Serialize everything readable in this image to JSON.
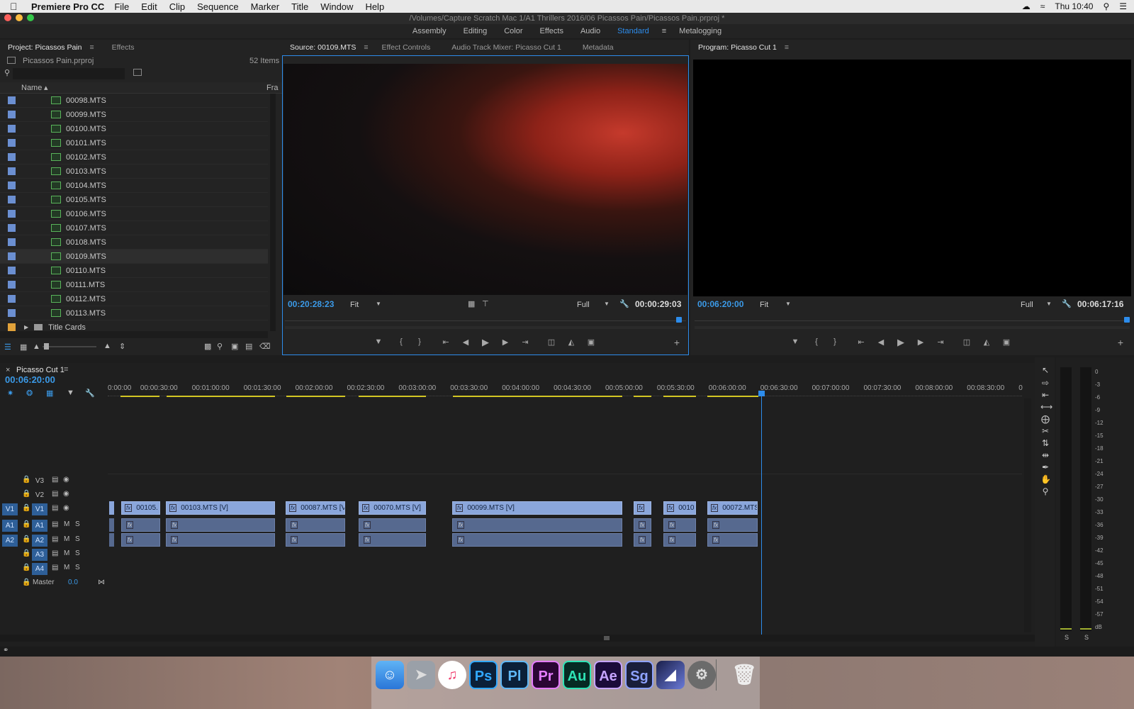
{
  "menubar": {
    "apple": "",
    "app": "Premiere Pro CC",
    "items": [
      "File",
      "Edit",
      "Clip",
      "Sequence",
      "Marker",
      "Title",
      "Window",
      "Help"
    ],
    "clock": "Thu 10:40"
  },
  "window": {
    "title": "/Volumes/Capture Scratch Mac 1/A1 Thrillers 2016/06 Picassos Pain/Picassos Pain.prproj *"
  },
  "workspaces": [
    "Assembly",
    "Editing",
    "Color",
    "Effects",
    "Audio",
    "Standard",
    "Metalogging"
  ],
  "workspace_active": "Standard",
  "project": {
    "tab_project": "Project: Picassos Pain",
    "tab_effects": "Effects",
    "file": "Picassos Pain.prproj",
    "count": "52 Items",
    "col_name": "Name",
    "col_fra": "Fra",
    "items": [
      "00098.MTS",
      "00099.MTS",
      "00100.MTS",
      "00101.MTS",
      "00102.MTS",
      "00103.MTS",
      "00104.MTS",
      "00105.MTS",
      "00106.MTS",
      "00107.MTS",
      "00108.MTS",
      "00109.MTS",
      "00110.MTS",
      "00111.MTS",
      "00112.MTS",
      "00113.MTS"
    ],
    "selected": "00109.MTS",
    "folder": "Title Cards"
  },
  "source": {
    "tabs": [
      "Source: 00109.MTS",
      "Effect Controls",
      "Audio Track Mixer: Picasso Cut 1",
      "Metadata"
    ],
    "timecode": "00:20:28:23",
    "fit": "Fit",
    "quality": "Full",
    "duration": "00:00:29:03"
  },
  "program": {
    "tab": "Program: Picasso Cut 1",
    "timecode": "00:06:20:00",
    "fit": "Fit",
    "quality": "Full",
    "duration": "00:06:17:16"
  },
  "timeline": {
    "tab": "Picasso Cut 1",
    "timecode": "00:06:20:00",
    "ruler": [
      "0:00:00",
      "00:00:30:00",
      "00:01:00:00",
      "00:01:30:00",
      "00:02:00:00",
      "00:02:30:00",
      "00:03:00:00",
      "00:03:30:00",
      "00:04:00:00",
      "00:04:30:00",
      "00:05:00:00",
      "00:05:30:00",
      "00:06:00:00",
      "00:06:30:00",
      "00:07:00:00",
      "00:07:30:00",
      "00:08:00:00",
      "00:08:30:00",
      "0"
    ],
    "tracks": {
      "v3": "V3",
      "v2": "V2",
      "v1": "V1",
      "a1": "A1",
      "a2": "A2",
      "a3": "A3",
      "a4": "A4",
      "master": "Master",
      "master_val": "0.0",
      "src_v1": "V1",
      "src_a1": "A1",
      "src_a2": "A2",
      "m": "M",
      "s": "S"
    },
    "clips": [
      "00105.",
      "00103.MTS [V]",
      "00087.MTS [V",
      "00070.MTS [V]",
      "00099.MTS [V]",
      "",
      "0010",
      "00072.MTS"
    ],
    "fx": "fx"
  },
  "meters": {
    "labels": [
      "0",
      "-3",
      "-6",
      "-9",
      "-12",
      "-15",
      "-18",
      "-21",
      "-24",
      "-27",
      "-30",
      "-33",
      "-36",
      "-39",
      "-42",
      "-45",
      "-48",
      "-51",
      "-54",
      "-57",
      "dB"
    ],
    "solo": [
      "S",
      "S"
    ]
  },
  "dock": [
    "Ps",
    "Pl",
    "Pr",
    "Au",
    "Ae",
    "Sg"
  ],
  "colors": {
    "accent": "#2d8ceb",
    "clip_video": "#8aa6db",
    "clip_audio": "#56698f",
    "label_blue": "#6b8fd1",
    "label_orange": "#e1a23a"
  }
}
